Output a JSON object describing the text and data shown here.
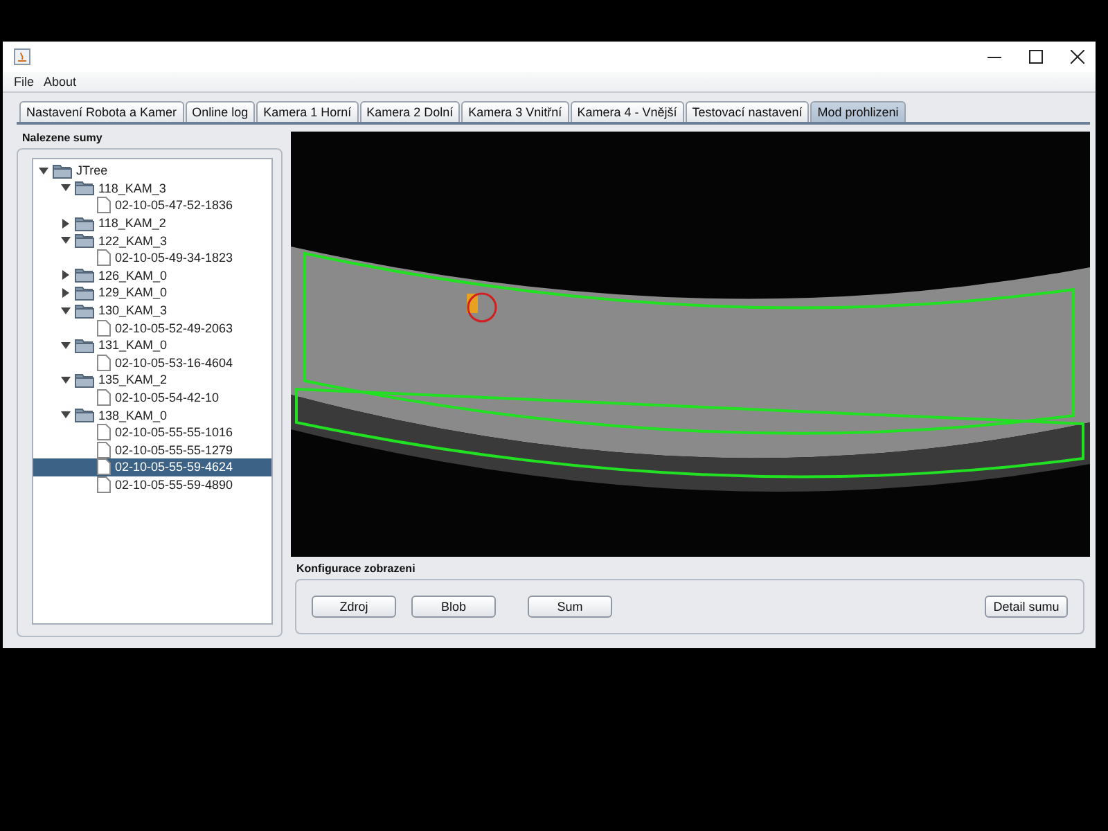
{
  "menu": [
    "File",
    "About"
  ],
  "tabs": [
    {
      "label": "Nastavení Robota a Kamer",
      "selected": false
    },
    {
      "label": "Online log",
      "selected": false
    },
    {
      "label": "Kamera 1 Horní",
      "selected": false
    },
    {
      "label": "Kamera 2 Dolní",
      "selected": false
    },
    {
      "label": "Kamera 3 Vnitřní",
      "selected": false
    },
    {
      "label": "Kamera 4 - Vnější",
      "selected": false
    },
    {
      "label": "Testovací nastavení",
      "selected": false
    },
    {
      "label": "Mod prohlizeni",
      "selected": true
    }
  ],
  "tree_panel": {
    "title": "Nalezene sumy",
    "tree": {
      "label": "JTree",
      "kind": "folder",
      "expanded": true,
      "children": [
        {
          "label": "118_KAM_3",
          "kind": "folder",
          "expanded": true,
          "children": [
            {
              "label": "02-10-05-47-52-1836",
              "kind": "file",
              "selected": false
            }
          ]
        },
        {
          "label": "118_KAM_2",
          "kind": "folder",
          "expanded": false
        },
        {
          "label": "122_KAM_3",
          "kind": "folder",
          "expanded": true,
          "children": [
            {
              "label": "02-10-05-49-34-1823",
              "kind": "file",
              "selected": false
            }
          ]
        },
        {
          "label": "126_KAM_0",
          "kind": "folder",
          "expanded": false
        },
        {
          "label": "129_KAM_0",
          "kind": "folder",
          "expanded": false
        },
        {
          "label": "130_KAM_3",
          "kind": "folder",
          "expanded": true,
          "children": [
            {
              "label": "02-10-05-52-49-2063",
              "kind": "file",
              "selected": false
            }
          ]
        },
        {
          "label": "131_KAM_0",
          "kind": "folder",
          "expanded": true,
          "children": [
            {
              "label": "02-10-05-53-16-4604",
              "kind": "file",
              "selected": false
            }
          ]
        },
        {
          "label": "135_KAM_2",
          "kind": "folder",
          "expanded": true,
          "children": [
            {
              "label": "02-10-05-54-42-10",
              "kind": "file",
              "selected": false
            }
          ]
        },
        {
          "label": "138_KAM_0",
          "kind": "folder",
          "expanded": true,
          "children": [
            {
              "label": "02-10-05-55-55-1016",
              "kind": "file",
              "selected": false
            },
            {
              "label": "02-10-05-55-55-1279",
              "kind": "file",
              "selected": false
            },
            {
              "label": "02-10-05-55-59-4624",
              "kind": "file",
              "selected": true
            },
            {
              "label": "02-10-05-55-59-4890",
              "kind": "file",
              "selected": false
            }
          ]
        }
      ]
    }
  },
  "display_config": {
    "title": "Konfigurace zobrazeni",
    "buttons": [
      "Zdroj",
      "Blob",
      "Sum"
    ],
    "detail_button": "Detail sumu"
  }
}
